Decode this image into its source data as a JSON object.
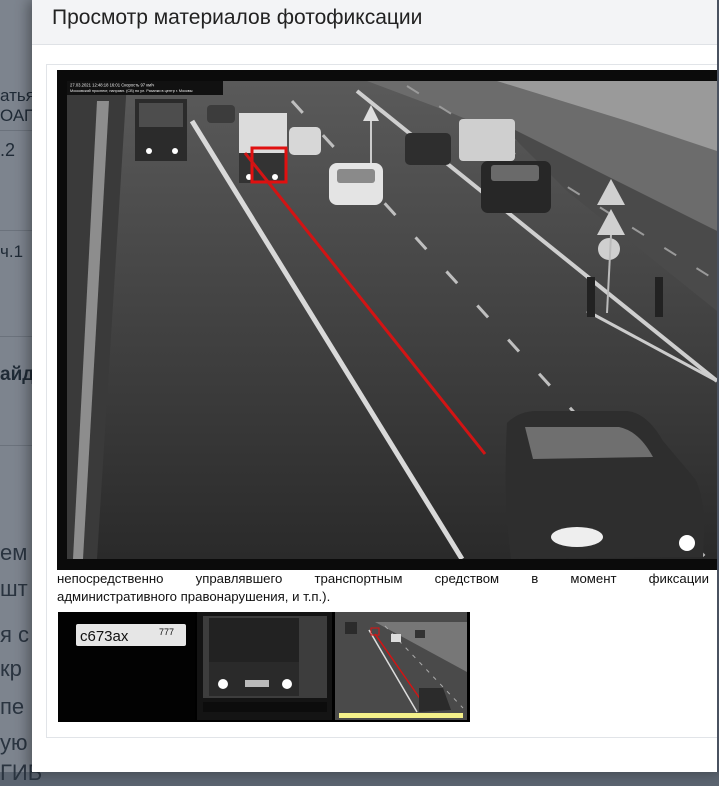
{
  "modal": {
    "title": "Просмотр материалов фотофиксации"
  },
  "photo": {
    "overlay_line1": "27.03.2021  12:48:18 16:01  Скорость 97 км/ч",
    "overlay_line2": "Московский проспект, направл. (СВ) по ул. Рязанки в центр г. Москвы",
    "icon": "traffic-camera-photo"
  },
  "description": {
    "line1": "непосредственно управлявшего транспортным средством в момент фиксации",
    "line2": "административного правонарушения, и т.п.)."
  },
  "thumbnails": [
    {
      "name": "plate",
      "plate_text": "с673ах",
      "region": "777"
    },
    {
      "name": "vehicle-closeup"
    },
    {
      "name": "overview",
      "selected": true
    }
  ],
  "background_fragments": [
    {
      "text": "атья"
    },
    {
      "text": "ОАП"
    },
    {
      "text": ".2"
    },
    {
      "text": "ч.1"
    },
    {
      "text": "айд"
    },
    {
      "text": "ем"
    },
    {
      "text": "шт"
    },
    {
      "text": "я с"
    },
    {
      "text": "кр"
    },
    {
      "text": "пе"
    },
    {
      "text": "ую"
    },
    {
      "text": "ГИБ"
    }
  ],
  "colors": {
    "modal_header_bg": "#f3f4f6",
    "backdrop": "#8b929c",
    "detection_box": "#e01010",
    "selected_thumb_accent": "#f4f08a"
  }
}
